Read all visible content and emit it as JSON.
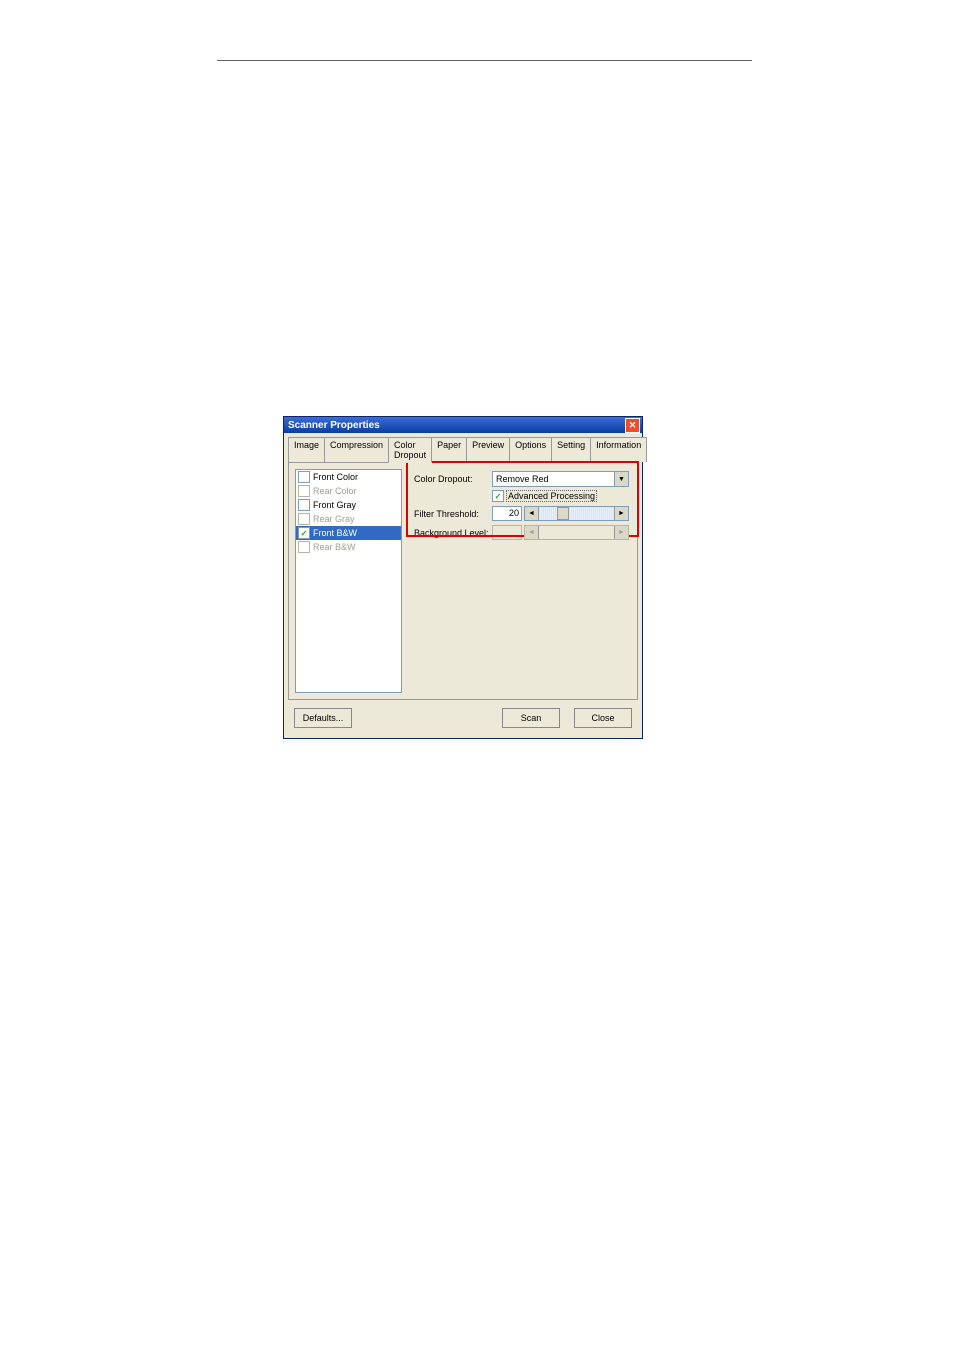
{
  "dialog": {
    "title": "Scanner Properties"
  },
  "tabs": [
    "Image",
    "Compression",
    "Color Dropout",
    "Paper",
    "Preview",
    "Options",
    "Setting",
    "Information"
  ],
  "left_panel": {
    "items": [
      {
        "label": "Front Color",
        "checked": false,
        "enabled": true,
        "selected": false
      },
      {
        "label": "Rear Color",
        "checked": false,
        "enabled": false,
        "selected": false
      },
      {
        "label": "Front Gray",
        "checked": false,
        "enabled": true,
        "selected": false
      },
      {
        "label": "Rear Gray",
        "checked": false,
        "enabled": false,
        "selected": false
      },
      {
        "label": "Front B&W",
        "checked": true,
        "enabled": true,
        "selected": true
      },
      {
        "label": "Rear B&W",
        "checked": false,
        "enabled": false,
        "selected": false
      }
    ]
  },
  "options": {
    "color_dropout": {
      "label": "Color Dropout:",
      "value": "Remove Red"
    },
    "advanced_processing": {
      "label": "Advanced Processing",
      "checked": true
    },
    "filter_threshold": {
      "label": "Filter Threshold:",
      "value": "20",
      "enabled": true
    },
    "background_level": {
      "label": "Background Level:",
      "value": "",
      "enabled": false
    }
  },
  "buttons": {
    "defaults": "Defaults...",
    "scan": "Scan",
    "close": "Close"
  }
}
